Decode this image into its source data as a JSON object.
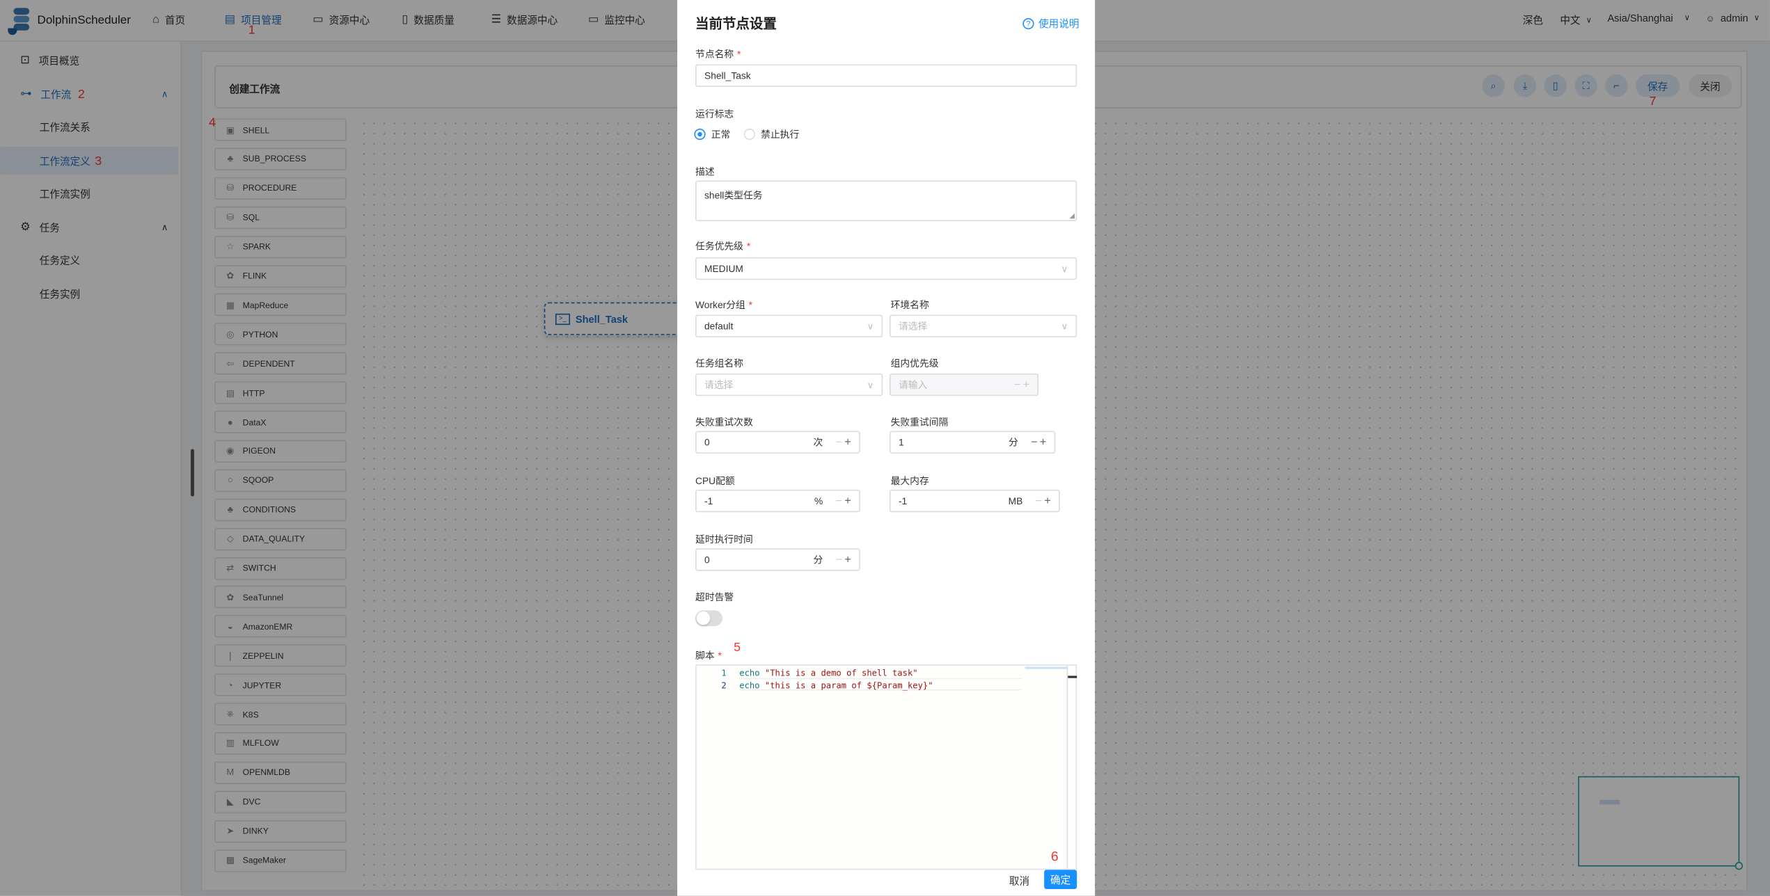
{
  "header": {
    "logo_text": "DolphinScheduler",
    "nav": [
      {
        "label": "首页",
        "icon": "home-icon"
      },
      {
        "label": "项目管理",
        "icon": "project-icon",
        "active": true
      },
      {
        "label": "资源中心",
        "icon": "folder-icon"
      },
      {
        "label": "数据质量",
        "icon": "data-quality-icon"
      },
      {
        "label": "数据源中心",
        "icon": "datasource-icon"
      },
      {
        "label": "监控中心",
        "icon": "monitor-icon"
      }
    ],
    "theme": "深色",
    "language": "中文",
    "timezone": "Asia/Shanghai",
    "user": "admin"
  },
  "annotations": {
    "a1": "1",
    "a2": "2",
    "a3": "3",
    "a4": "4",
    "a5": "5",
    "a6": "6",
    "a7": "7"
  },
  "sidebar": {
    "items": [
      {
        "label": "项目概览"
      },
      {
        "label": "工作流"
      },
      {
        "label": "工作流关系"
      },
      {
        "label": "工作流定义"
      },
      {
        "label": "工作流实例"
      },
      {
        "label": "任务"
      },
      {
        "label": "任务定义"
      },
      {
        "label": "任务实例"
      }
    ]
  },
  "toolbar": {
    "title": "创建工作流",
    "save": "保存",
    "close": "关闭"
  },
  "task_types": [
    "SHELL",
    "SUB_PROCESS",
    "PROCEDURE",
    "SQL",
    "SPARK",
    "FLINK",
    "MapReduce",
    "PYTHON",
    "DEPENDENT",
    "HTTP",
    "DataX",
    "PIGEON",
    "SQOOP",
    "CONDITIONS",
    "DATA_QUALITY",
    "SWITCH",
    "SeaTunnel",
    "AmazonEMR",
    "ZEPPELIN",
    "JUPYTER",
    "K8S",
    "MLFLOW",
    "OPENMLDB",
    "DVC",
    "DINKY",
    "SageMaker"
  ],
  "canvas": {
    "node_label": "Shell_Task"
  },
  "modal": {
    "title": "当前节点设置",
    "help": "使用说明",
    "node_name_label": "节点名称",
    "node_name": "Shell_Task",
    "run_flag_label": "运行标志",
    "run_normal": "正常",
    "run_forbidden": "禁止执行",
    "desc_label": "描述",
    "desc": "shell类型任务",
    "priority_label": "任务优先级",
    "priority": "MEDIUM",
    "worker_label": "Worker分组",
    "worker": "default",
    "env_label": "环境名称",
    "env_placeholder": "请选择",
    "task_group_label": "任务组名称",
    "task_group_placeholder": "请选择",
    "group_priority_label": "组内优先级",
    "group_priority_placeholder": "请输入",
    "retry_times_label": "失败重试次数",
    "retry_times": "0",
    "retry_times_unit": "次",
    "retry_interval_label": "失败重试间隔",
    "retry_interval": "1",
    "retry_interval_unit": "分",
    "cpu_label": "CPU配额",
    "cpu": "-1",
    "cpu_unit": "%",
    "memory_label": "最大内存",
    "memory": "-1",
    "memory_unit": "MB",
    "delay_label": "延时执行时间",
    "delay": "0",
    "delay_unit": "分",
    "timeout_label": "超时告警",
    "timeout_enabled": false,
    "script_label": "脚本",
    "script_lines": [
      {
        "no": "1",
        "kw": "echo",
        "str": " \"This is a demo of shell task\""
      },
      {
        "no": "2",
        "kw": "echo",
        "str": " \"this is a param of ${Param_key}\""
      }
    ],
    "cancel": "取消",
    "confirm": "确定"
  },
  "colors": {
    "accent": "#1890ff",
    "brand_blue": "#1f6fc2",
    "minimap": "#1aa39a",
    "annotation": "#ff3333"
  }
}
